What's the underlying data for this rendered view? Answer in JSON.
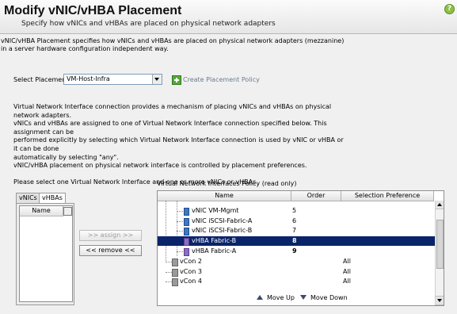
{
  "header": {
    "title": "Modify vNIC/vHBA Placement",
    "subtitle": "Specify how vNICs and vHBAs are placed on physical network adapters"
  },
  "description": {
    "line1": "vNIC/vHBA Placement specifies how vNICs and vHBAs are placed on physical network adapters (mezzanine)",
    "line2": "in a server hardware configuration independent way."
  },
  "placement": {
    "label": "Select Placement:",
    "value": "VM-Host-Infra",
    "create_link": "Create Placement Policy"
  },
  "info": {
    "line1": "Virtual Network Interface connection provides a mechanism of placing vNICs and vHBAs on physical network adapters.",
    "line2": "vNICs and vHBAs are assigned to one of Virtual Network Interface connection specified below. This assignment can be",
    "line3": "performed explicitly by selecting which Virtual Network Interface connection is used by vNIC or vHBA or it can be done",
    "line4": "automatically by selecting \"any\".",
    "line5": "vNIC/vHBA placement on physical network interface is controlled by placement preferences.",
    "line6": "Please select one Virtual Network Interface and one or more vNICs or vHBAs"
  },
  "left_panel": {
    "tabs": [
      "vNICs",
      "vHBAs"
    ],
    "column": "Name"
  },
  "buttons": {
    "assign": ">> assign >>",
    "remove": "<< remove <<"
  },
  "policy": {
    "title": "Virtual Network Interfaces Policy (read only)",
    "columns": [
      "Name",
      "Order",
      "Selection Preference"
    ],
    "rows": [
      {
        "name": "vNIC VM-Mgmt",
        "order": "5",
        "pref": "",
        "type": "vnic"
      },
      {
        "name": "vNIC iSCSI-Fabric-A",
        "order": "6",
        "pref": "",
        "type": "vnic"
      },
      {
        "name": "vNIC iSCSI-Fabric-B",
        "order": "7",
        "pref": "",
        "type": "vnic"
      },
      {
        "name": "vHBA Fabric-B",
        "order": "8",
        "pref": "",
        "type": "vhba"
      },
      {
        "name": "vHBA Fabric-A",
        "order": "9",
        "pref": "",
        "type": "vhba"
      },
      {
        "name": "vCon 2",
        "order": "",
        "pref": "All",
        "type": "vcon"
      },
      {
        "name": "vCon 3",
        "order": "",
        "pref": "All",
        "type": "vcon"
      },
      {
        "name": "vCon 4",
        "order": "",
        "pref": "All",
        "type": "vcon"
      }
    ],
    "selected_row": "vHBA Fabric-B"
  },
  "move": {
    "up": "Move Up",
    "down": "Move Down"
  },
  "colors": {
    "selection": "#0a246a",
    "accent_green": "#56a83a"
  }
}
